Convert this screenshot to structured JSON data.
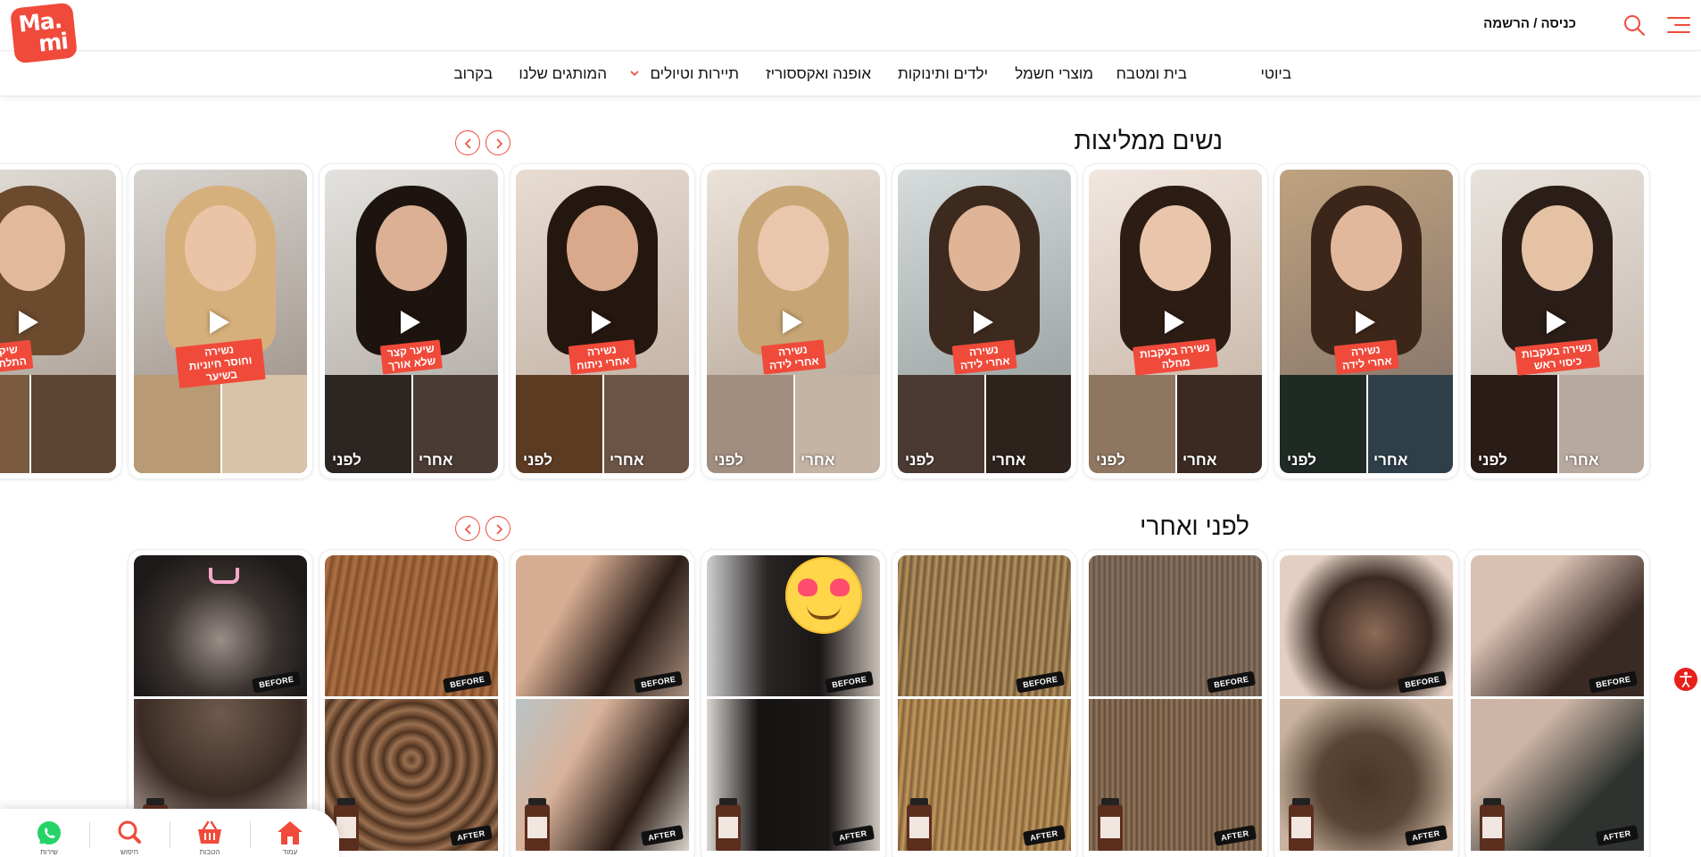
{
  "header": {
    "logo_line1": "Ma.",
    "logo_line2": "mi",
    "login_label": "כניסה / הרשמה"
  },
  "nav": {
    "items": [
      "ביוטי",
      "בית ומטבח",
      "מוצרי חשמל",
      "ילדים ותינוקות",
      "אופנה ואקססוריז",
      "תיירות וטיולים",
      "המותגים שלנו",
      "בקרוב"
    ]
  },
  "testimonials": {
    "title": "נשים ממליצות",
    "cards": [
      {
        "tag": "נשירה בעקבות\nכיסוי ראש",
        "before": "לפני",
        "after": "אחרי"
      },
      {
        "tag": "נשירה\nאחרי לידה",
        "before": "לפני",
        "after": "אחרי"
      },
      {
        "tag": "נשירה בעקבות\nמחלה",
        "before": "לפני",
        "after": "אחרי"
      },
      {
        "tag": "נשירה\nאחרי לידה",
        "before": "לפני",
        "after": "אחרי"
      },
      {
        "tag": "נשירה\nאחרי לידה",
        "before": "לפני",
        "after": "אחרי"
      },
      {
        "tag": "נשירה\nאחרי ניתוח",
        "before": "לפני",
        "after": "אחרי"
      },
      {
        "tag": "שיער קצר\nשלא אורך",
        "before": "לפני",
        "after": "אחרי"
      },
      {
        "tag": "נשירה\nוחוסר חיוניות בשיער",
        "before": "",
        "after": ""
      },
      {
        "tag": "שיקום\nהתלתלים",
        "before": "",
        "after": ""
      }
    ]
  },
  "before_after": {
    "title": "לפני ואחרי",
    "before_label": "BEFORE",
    "after_label": "AFTER"
  },
  "bottom_bar": {
    "home": "עמוד",
    "cart": "הטבות",
    "search": "חיפוש",
    "whatsapp": "שירות"
  },
  "colors": {
    "accent": "#f04a3a",
    "text": "#111111",
    "whatsapp": "#25d366"
  },
  "icons": [
    "menu-icon",
    "search-icon",
    "chevron-down-icon",
    "chevron-left-icon",
    "chevron-right-icon",
    "play-icon",
    "home-icon",
    "basket-icon",
    "magnifier-icon",
    "whatsapp-icon",
    "accessibility-icon"
  ]
}
